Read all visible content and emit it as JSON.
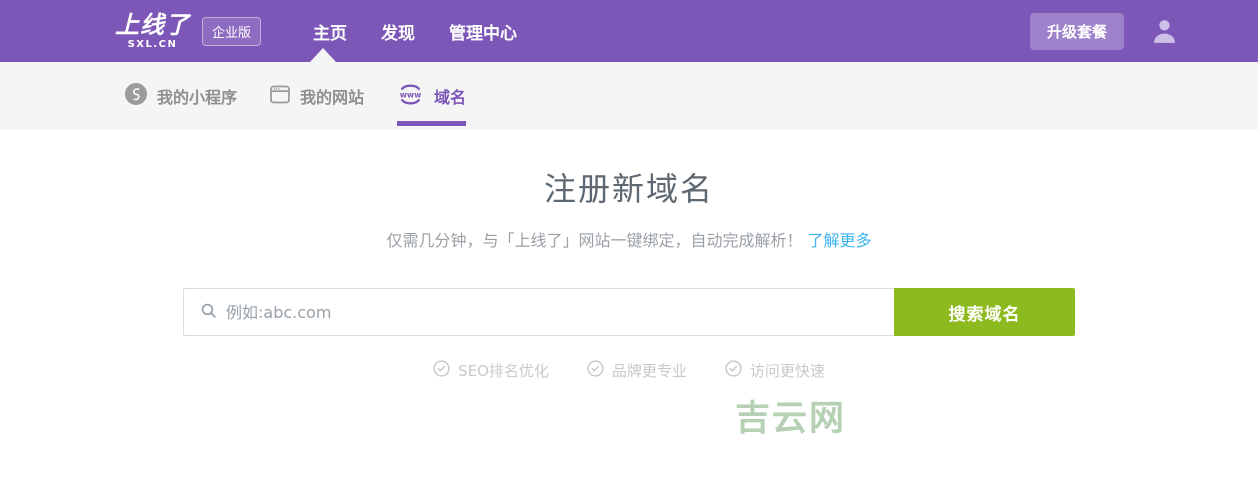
{
  "header": {
    "logo": {
      "title": "上线了",
      "subtitle": "SXL.CN"
    },
    "badge": "企业版",
    "nav": [
      {
        "label": "主页",
        "active": true
      },
      {
        "label": "发现",
        "active": false
      },
      {
        "label": "管理中心",
        "active": false
      }
    ],
    "upgrade_button": "升级套餐"
  },
  "subnav": {
    "tabs": [
      {
        "label": "我的小程序",
        "icon": "miniprogram-icon",
        "active": false
      },
      {
        "label": "我的网站",
        "icon": "website-window-icon",
        "active": false
      },
      {
        "label": "域名",
        "icon": "www-globe-icon",
        "active": true
      }
    ],
    "www_icon_text": "www"
  },
  "main": {
    "title": "注册新域名",
    "subtitle": "仅需几分钟，与「上线了」网站一键绑定，自动完成解析！",
    "learn_more": "了解更多",
    "search": {
      "placeholder": "例如:abc.com",
      "button_label": "搜索域名"
    },
    "features": [
      "SEO排名优化",
      "品牌更专业",
      "访问更快速"
    ],
    "watermark": "吉云网"
  },
  "icons": {
    "search": "search-icon",
    "check": "check-circle-icon",
    "user": "user-icon",
    "miniprogram": "miniprogram-icon",
    "website": "website-window-icon",
    "www": "www-globe-icon"
  },
  "colors": {
    "header_purple": "#7d57b8",
    "subnav_gray": "#f5f5f5",
    "active_tab_purple": "#7d57b8",
    "button_green": "#8cba1f",
    "link_blue": "#3eb3f2",
    "title_gray": "#5d6872",
    "feature_gray": "#c9c9c9",
    "watermark_green": "#a9c8a6"
  }
}
